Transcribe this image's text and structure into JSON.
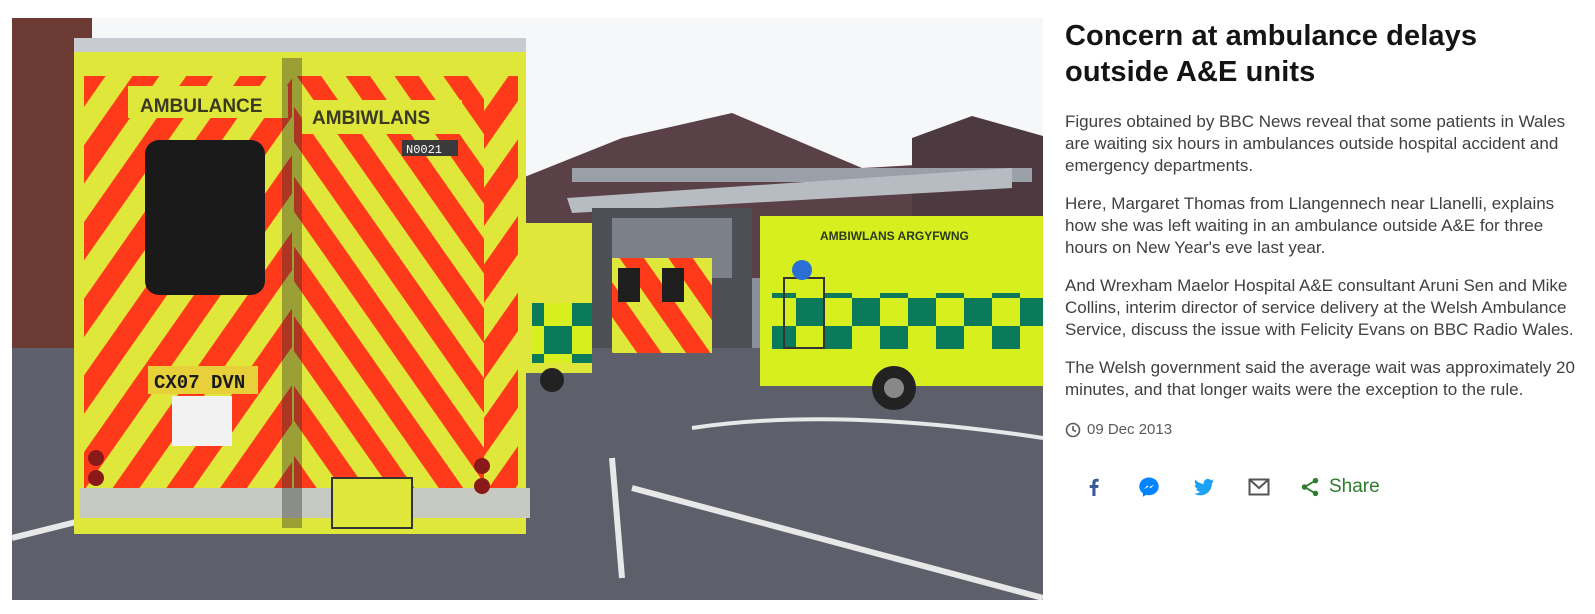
{
  "article": {
    "headline": "Concern at ambulance delays outside A&E units",
    "paragraphs": [
      "Figures obtained by BBC News reveal that some patients in Wales are waiting six hours in ambulances outside hospital accident and emergency departments.",
      "Here, Margaret Thomas from Llangennech near Llanelli, explains how she was left waiting in an ambulance outside A&E for three hours on New Year's eve last year.",
      "And Wrexham Maelor Hospital A&E consultant Aruni Sen and Mike Collins, interim director of service delivery at the Welsh Ambulance Service, discuss the issue with Felicity Evans on BBC Radio Wales.",
      "The Welsh government said the average wait was approximately 20 minutes, and that longer waits were the exception to the rule."
    ],
    "date": "09 Dec 2013"
  },
  "media": {
    "ambulance_label_en": "AMBULANCE",
    "ambulance_label_cy": "AMBIWLANS",
    "fleet_number": "N0021",
    "registration": "CX07 DVN",
    "side_label": "AMBIWLANS   ARGYFWNG"
  },
  "share": {
    "buttons": [
      {
        "name": "facebook",
        "icon": "facebook-icon",
        "color": "#3b5998"
      },
      {
        "name": "messenger",
        "icon": "messenger-icon",
        "color": "#0084ff"
      },
      {
        "name": "twitter",
        "icon": "twitter-icon",
        "color": "#1da1f2"
      },
      {
        "name": "email",
        "icon": "email-icon",
        "color": "#545454"
      }
    ],
    "more_label": "Share",
    "more_color": "#2d7d2d"
  }
}
